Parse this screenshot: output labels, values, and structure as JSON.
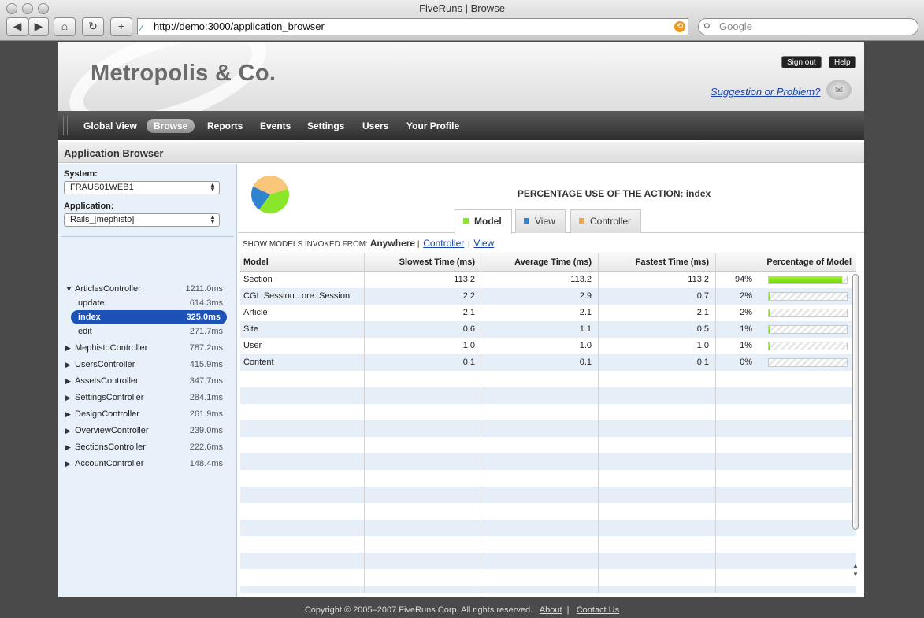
{
  "window": {
    "title": "FiveRuns | Browse"
  },
  "browser": {
    "url": "http://demo:3000/application_browser",
    "search_placeholder": "Google",
    "buttons": {
      "back": "◀",
      "forward": "▶",
      "home": "⌂",
      "reload": "↻",
      "new_tab": "+"
    }
  },
  "header": {
    "logo": "Metropolis & Co.",
    "sign_out": "Sign out",
    "help": "Help",
    "suggestion": "Suggestion or Problem?"
  },
  "nav": {
    "items": [
      "Global View",
      "Browse",
      "Reports",
      "Events",
      "Settings",
      "Users",
      "Your Profile"
    ],
    "active": "Browse"
  },
  "section": {
    "title": "Application Browser"
  },
  "sidebar": {
    "system_label": "System:",
    "system_value": "FRAUS01WEB1",
    "application_label": "Application:",
    "application_value": "Rails_[mephisto]",
    "controllers": [
      {
        "name": "ArticlesController",
        "time": "1211.0ms",
        "expanded": true,
        "actions": [
          {
            "name": "update",
            "time": "614.3ms"
          },
          {
            "name": "index",
            "time": "325.0ms",
            "selected": true
          },
          {
            "name": "edit",
            "time": "271.7ms"
          }
        ]
      },
      {
        "name": "MephistoController",
        "time": "787.2ms"
      },
      {
        "name": "UsersController",
        "time": "415.9ms"
      },
      {
        "name": "AssetsController",
        "time": "347.7ms"
      },
      {
        "name": "SettingsController",
        "time": "284.1ms"
      },
      {
        "name": "DesignController",
        "time": "261.9ms"
      },
      {
        "name": "OverviewController",
        "time": "239.0ms"
      },
      {
        "name": "SectionsController",
        "time": "222.6ms"
      },
      {
        "name": "AccountController",
        "time": "148.4ms"
      }
    ]
  },
  "main": {
    "chart_title": "PERCENTAGE USE OF THE ACTION: index",
    "tabs": [
      {
        "label": "Model",
        "color": "#8ae62a",
        "active": true
      },
      {
        "label": "View",
        "color": "#2f83cf"
      },
      {
        "label": "Controller",
        "color": "#f5a742"
      }
    ],
    "filter": {
      "prefix": "SHOW MODELS INVOKED FROM:",
      "current": "Anywhere",
      "link1": "Controller",
      "sep": "|",
      "link2": "View"
    },
    "columns": [
      "Model",
      "Slowest Time (ms)",
      "Average Time (ms)",
      "Fastest Time (ms)",
      "",
      "Percentage of Model"
    ],
    "rows": [
      {
        "model": "Section",
        "slowest": "113.2",
        "average": "113.2",
        "fastest": "113.2",
        "pct_label": "94%",
        "pct": 94
      },
      {
        "model": "CGI::Session...ore::Session",
        "slowest": "2.2",
        "average": "2.9",
        "fastest": "0.7",
        "pct_label": "2%",
        "pct": 2
      },
      {
        "model": "Article",
        "slowest": "2.1",
        "average": "2.1",
        "fastest": "2.1",
        "pct_label": "2%",
        "pct": 2
      },
      {
        "model": "Site",
        "slowest": "0.6",
        "average": "1.1",
        "fastest": "0.5",
        "pct_label": "1%",
        "pct": 1
      },
      {
        "model": "User",
        "slowest": "1.0",
        "average": "1.0",
        "fastest": "1.0",
        "pct_label": "1%",
        "pct": 1
      },
      {
        "model": "Content",
        "slowest": "0.1",
        "average": "0.1",
        "fastest": "0.1",
        "pct_label": "0%",
        "pct": 0
      }
    ],
    "pie": [
      {
        "name": "Model",
        "value": 40,
        "color": "#8ae62a"
      },
      {
        "name": "View",
        "value": 22,
        "color": "#2f83cf"
      },
      {
        "name": "Controller",
        "value": 38,
        "color": "#f9c57a"
      }
    ]
  },
  "footer": {
    "copyright": "Copyright © 2005–2007 FiveRuns Corp. All rights reserved.",
    "about": "About",
    "sep": "|",
    "contact": "Contact Us"
  }
}
